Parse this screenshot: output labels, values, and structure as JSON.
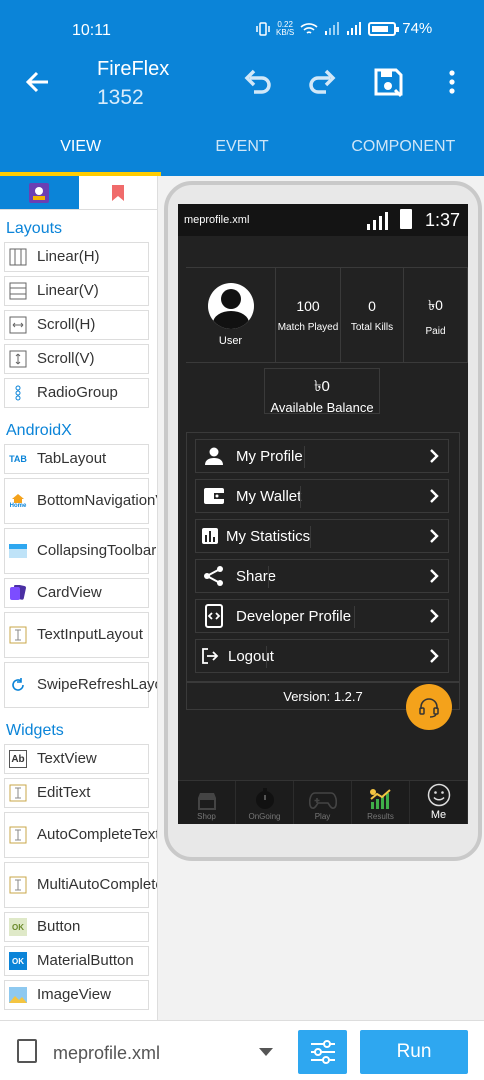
{
  "status_bar": {
    "time": "10:11",
    "speed_value": "0.22",
    "speed_unit": "KB/S",
    "battery": "74%"
  },
  "app_bar": {
    "title": "FireFlex",
    "subtitle": "1352",
    "icons": [
      "back-arrow-icon",
      "undo-icon",
      "redo-icon",
      "save-icon",
      "more-vert-icon"
    ]
  },
  "tabs": [
    {
      "label": "VIEW",
      "active": true
    },
    {
      "label": "EVENT",
      "active": false
    },
    {
      "label": "COMPONENT",
      "active": false
    }
  ],
  "palette": {
    "sections": {
      "layouts": "Layouts",
      "androidx": "AndroidX",
      "widgets": "Widgets"
    },
    "layouts": [
      "Linear(H)",
      "Linear(V)",
      "Scroll(H)",
      "Scroll(V)",
      "RadioGroup"
    ],
    "androidx": [
      "TabLayout",
      "BottomNavigationView",
      "CollapsingToolbar",
      "CardView",
      "TextInputLayout",
      "SwipeRefreshLayout"
    ],
    "widgets": [
      "TextView",
      "EditText",
      "AutoCompleteTextView",
      "MultiAutoCompleteTextView",
      "Button",
      "MaterialButton",
      "ImageView"
    ],
    "icon_text": {
      "tab": "TAB",
      "home": "Home",
      "ab": "Ab",
      "ok": "OK"
    }
  },
  "preview": {
    "file": "meprofile.xml",
    "time": "1:37",
    "user_label": "User",
    "stats": [
      {
        "value": "100",
        "label": "Match Played"
      },
      {
        "value": "0",
        "label": "Total Kills"
      },
      {
        "value": "৳0",
        "label": "Paid"
      }
    ],
    "balance_value": "৳0",
    "balance_label": "Available Balance",
    "menu": [
      {
        "label": "My Profile",
        "icon": "person-icon"
      },
      {
        "label": "My Wallet",
        "icon": "wallet-icon"
      },
      {
        "label": "My Statistics",
        "icon": "statistics-icon"
      },
      {
        "label": "Share",
        "icon": "share-icon"
      },
      {
        "label": "Developer Profile",
        "icon": "developer-icon"
      },
      {
        "label": "Logout",
        "icon": "logout-icon"
      }
    ],
    "version": "Version: 1.2.7",
    "bottom_nav": [
      {
        "label": "Shop",
        "active": false
      },
      {
        "label": "OnGoing",
        "active": false
      },
      {
        "label": "Play",
        "active": false
      },
      {
        "label": "Results",
        "active": false
      },
      {
        "label": "Me",
        "active": true
      }
    ],
    "accent_color": "#f4a21b"
  },
  "bottom_bar": {
    "file_name": "meprofile.xml",
    "run_label": "Run"
  },
  "colors": {
    "primary": "#0b84d8",
    "tab_indicator": "#ffcc00",
    "button": "#2ea7f0"
  }
}
